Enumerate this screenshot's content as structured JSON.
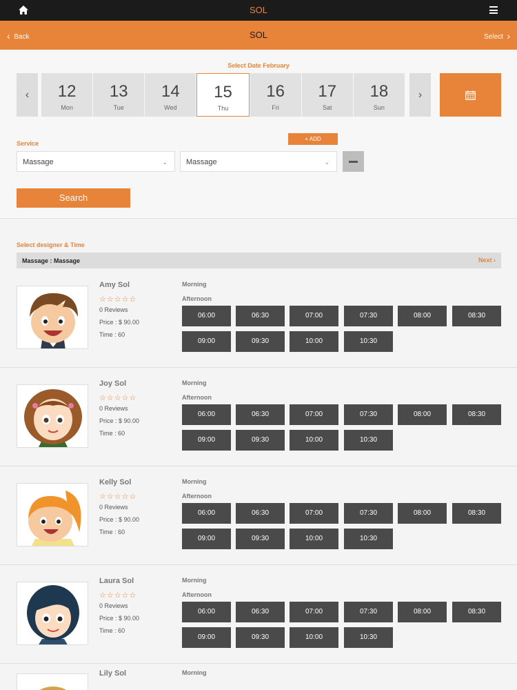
{
  "topbar": {
    "title": "SOL",
    "home_icon": "home-icon",
    "menu_icon": "hamburger-menu-icon"
  },
  "navbar": {
    "back_label": "Back",
    "title": "SOL",
    "select_label": "Select"
  },
  "date_picker": {
    "label": "Select Date February",
    "days": [
      {
        "num": "12",
        "dow": "Mon",
        "active": false
      },
      {
        "num": "13",
        "dow": "Tue",
        "active": false
      },
      {
        "num": "14",
        "dow": "Wed",
        "active": false
      },
      {
        "num": "15",
        "dow": "Thu",
        "active": true
      },
      {
        "num": "16",
        "dow": "Fri",
        "active": false
      },
      {
        "num": "17",
        "dow": "Sat",
        "active": false
      },
      {
        "num": "18",
        "dow": "Sun",
        "active": false
      }
    ],
    "prev_glyph": "‹",
    "next_glyph": "›"
  },
  "service": {
    "label": "Service",
    "add_label": "+ ADD",
    "select1": "Massage",
    "select2": "Massage",
    "search_label": "Search"
  },
  "designer_section": {
    "label": "Select designer & Time",
    "bar_service": "Massage : Massage",
    "next_label": "Next ›"
  },
  "designers": [
    {
      "name": "Amy Sol",
      "stars": "☆☆☆☆☆",
      "reviews": "0 Reviews",
      "price": "Price : $ 90.00",
      "time": "Time : 60",
      "avatar": "boy"
    },
    {
      "name": "Joy Sol",
      "stars": "☆☆☆☆☆",
      "reviews": "0 Reviews",
      "price": "Price : $ 90.00",
      "time": "Time : 60",
      "avatar": "curly"
    },
    {
      "name": "Kelly Sol",
      "stars": "☆☆☆☆☆",
      "reviews": "0 Reviews",
      "price": "Price : $ 90.00",
      "time": "Time : 60",
      "avatar": "ponytail"
    },
    {
      "name": "Laura Sol",
      "stars": "☆☆☆☆☆",
      "reviews": "0 Reviews",
      "price": "Price : $ 90.00",
      "time": "Time : 60",
      "avatar": "bob"
    }
  ],
  "partial_designer": {
    "name": "Lily Sol",
    "morning": "Morning"
  },
  "labels": {
    "morning": "Morning",
    "afternoon": "Afternoon"
  },
  "time_slots": [
    "06:00",
    "06:30",
    "07:00",
    "07:30",
    "08:00",
    "08:30",
    "09:00",
    "09:30",
    "10:00",
    "10:30"
  ],
  "colors": {
    "accent": "#e8843a",
    "topbar": "#1b1b1b",
    "slot": "#4a4a4a"
  }
}
